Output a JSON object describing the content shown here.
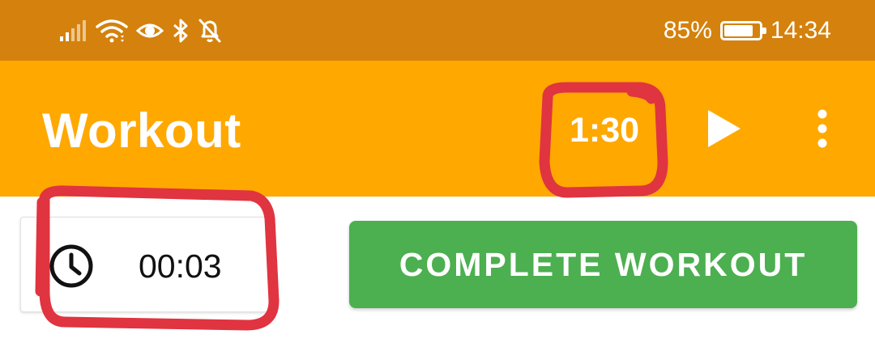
{
  "status_bar": {
    "icons": [
      "signal-icon",
      "wifi-icon",
      "eye-icon",
      "bluetooth-icon",
      "notifications-off-icon"
    ],
    "battery_percent": "85%",
    "battery_level": 0.85,
    "time": "14:34"
  },
  "app_bar": {
    "title": "Workout",
    "rest_timer": "1:30",
    "play_icon": "play-icon",
    "more_icon": "more-vert-icon"
  },
  "workout": {
    "clock_icon": "clock-icon",
    "elapsed": "00:03",
    "complete_label": "COMPLETE WORKOUT"
  },
  "colors": {
    "status_bar": "#d4820d",
    "app_bar": "#ffa800",
    "complete_button": "#4caf50",
    "annotation": "#e03440"
  }
}
